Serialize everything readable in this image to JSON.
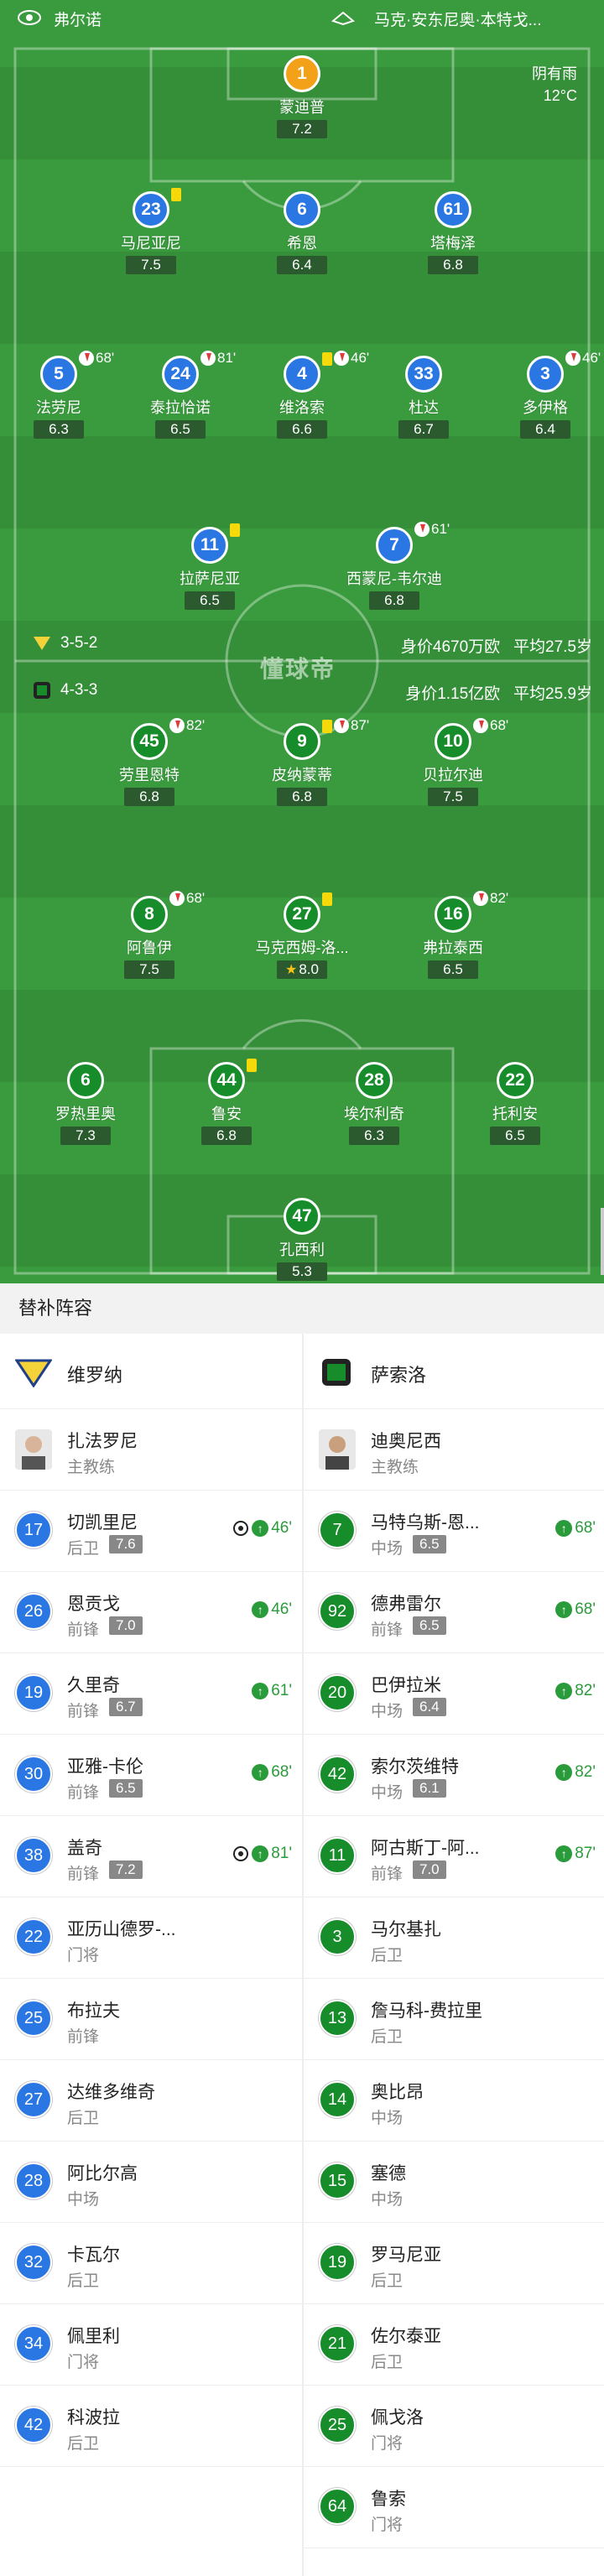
{
  "header": {
    "home_team": "弗尔诺",
    "away_team_players": "马克·安东尼奥·本特戈...",
    "weather": "阴有雨",
    "temperature": "12°C"
  },
  "colors": {
    "home": "#2a77e3",
    "away": "#178c2a",
    "gk_home": "#f4a11a",
    "pitch": "#3a9b3e"
  },
  "home_info": {
    "formation": "3-5-2",
    "value": "身价4670万欧",
    "avg_age": "平均27.5岁"
  },
  "away_info": {
    "formation": "4-3-3",
    "value": "身价1.15亿欧",
    "avg_age": "平均25.9岁"
  },
  "watermark": "懂球帝",
  "home_lineup": [
    {
      "num": "1",
      "name": "蒙迪普",
      "rating": "7.2",
      "gk": true
    },
    {
      "num": "23",
      "name": "马尼亚尼",
      "rating": "7.5",
      "yellow": true
    },
    {
      "num": "6",
      "name": "希恩",
      "rating": "6.4"
    },
    {
      "num": "61",
      "name": "塔梅泽",
      "rating": "6.8"
    },
    {
      "num": "5",
      "name": "法劳尼",
      "rating": "6.3",
      "sub_out": "68'"
    },
    {
      "num": "24",
      "name": "泰拉恰诺",
      "rating": "6.5",
      "sub_out": "81'"
    },
    {
      "num": "4",
      "name": "维洛索",
      "rating": "6.6",
      "sub_out": "46'",
      "yellow": true
    },
    {
      "num": "33",
      "name": "杜达",
      "rating": "6.7"
    },
    {
      "num": "3",
      "name": "多伊格",
      "rating": "6.4",
      "sub_out": "46'"
    },
    {
      "num": "11",
      "name": "拉萨尼亚",
      "rating": "6.5",
      "yellow": true
    },
    {
      "num": "7",
      "name": "西蒙尼-韦尔迪",
      "rating": "6.8",
      "sub_out": "61'"
    }
  ],
  "away_lineup": [
    {
      "num": "45",
      "name": "劳里恩特",
      "rating": "6.8",
      "sub_out": "82'"
    },
    {
      "num": "9",
      "name": "皮纳蒙蒂",
      "rating": "6.8",
      "sub_out": "87'",
      "yellow": true
    },
    {
      "num": "10",
      "name": "贝拉尔迪",
      "rating": "7.5",
      "sub_out": "68'"
    },
    {
      "num": "8",
      "name": "阿鲁伊",
      "rating": "7.5",
      "sub_out": "68'",
      "goal": true
    },
    {
      "num": "27",
      "name": "马克西姆-洛...",
      "rating": "8.0",
      "yellow": true,
      "best": true
    },
    {
      "num": "16",
      "name": "弗拉泰西",
      "rating": "6.5",
      "sub_out": "82'"
    },
    {
      "num": "6",
      "name": "罗热里奥",
      "rating": "7.3"
    },
    {
      "num": "44",
      "name": "鲁安",
      "rating": "6.8",
      "yellow": true
    },
    {
      "num": "28",
      "name": "埃尔利奇",
      "rating": "6.3"
    },
    {
      "num": "22",
      "name": "托利安",
      "rating": "6.5"
    },
    {
      "num": "47",
      "name": "孔西利",
      "rating": "5.3",
      "gk": true
    }
  ],
  "subs": {
    "title": "替补阵容",
    "home_team": "维罗纳",
    "away_team": "萨索洛",
    "home_coach": {
      "name": "扎法罗尼",
      "role": "主教练"
    },
    "away_coach": {
      "name": "迪奥尼西",
      "role": "主教练"
    },
    "home": [
      {
        "num": "17",
        "name": "切凯里尼",
        "pos": "后卫",
        "rating": "7.6",
        "in": "46'",
        "goal": true
      },
      {
        "num": "26",
        "name": "恩贡戈",
        "pos": "前锋",
        "rating": "7.0",
        "in": "46'"
      },
      {
        "num": "19",
        "name": "久里奇",
        "pos": "前锋",
        "rating": "6.7",
        "in": "61'"
      },
      {
        "num": "30",
        "name": "亚雅-卡伦",
        "pos": "前锋",
        "rating": "6.5",
        "in": "68'"
      },
      {
        "num": "38",
        "name": "盖奇",
        "pos": "前锋",
        "rating": "7.2",
        "in": "81'",
        "goal": true
      },
      {
        "num": "22",
        "name": "亚历山德罗-...",
        "pos": "门将"
      },
      {
        "num": "25",
        "name": "布拉夫",
        "pos": "前锋"
      },
      {
        "num": "27",
        "name": "达维多维奇",
        "pos": "后卫"
      },
      {
        "num": "28",
        "name": "阿比尔高",
        "pos": "中场"
      },
      {
        "num": "32",
        "name": "卡瓦尔",
        "pos": "后卫"
      },
      {
        "num": "34",
        "name": "佩里利",
        "pos": "门将"
      },
      {
        "num": "42",
        "name": "科波拉",
        "pos": "后卫"
      }
    ],
    "away": [
      {
        "num": "7",
        "name": "马特乌斯-恩...",
        "pos": "中场",
        "rating": "6.5",
        "in": "68'"
      },
      {
        "num": "92",
        "name": "德弗雷尔",
        "pos": "前锋",
        "rating": "6.5",
        "in": "68'"
      },
      {
        "num": "20",
        "name": "巴伊拉米",
        "pos": "中场",
        "rating": "6.4",
        "in": "82'"
      },
      {
        "num": "42",
        "name": "索尔茨维特",
        "pos": "中场",
        "rating": "6.1",
        "in": "82'"
      },
      {
        "num": "11",
        "name": "阿古斯丁-阿...",
        "pos": "前锋",
        "rating": "7.0",
        "in": "87'"
      },
      {
        "num": "3",
        "name": "马尔基扎",
        "pos": "后卫"
      },
      {
        "num": "13",
        "name": "詹马科-费拉里",
        "pos": "后卫"
      },
      {
        "num": "14",
        "name": "奥比昂",
        "pos": "中场"
      },
      {
        "num": "15",
        "name": "塞德",
        "pos": "中场"
      },
      {
        "num": "19",
        "name": "罗马尼亚",
        "pos": "后卫"
      },
      {
        "num": "21",
        "name": "佐尔泰亚",
        "pos": "后卫"
      },
      {
        "num": "25",
        "name": "佩戈洛",
        "pos": "门将"
      },
      {
        "num": "64",
        "name": "鲁索",
        "pos": "门将"
      }
    ]
  }
}
